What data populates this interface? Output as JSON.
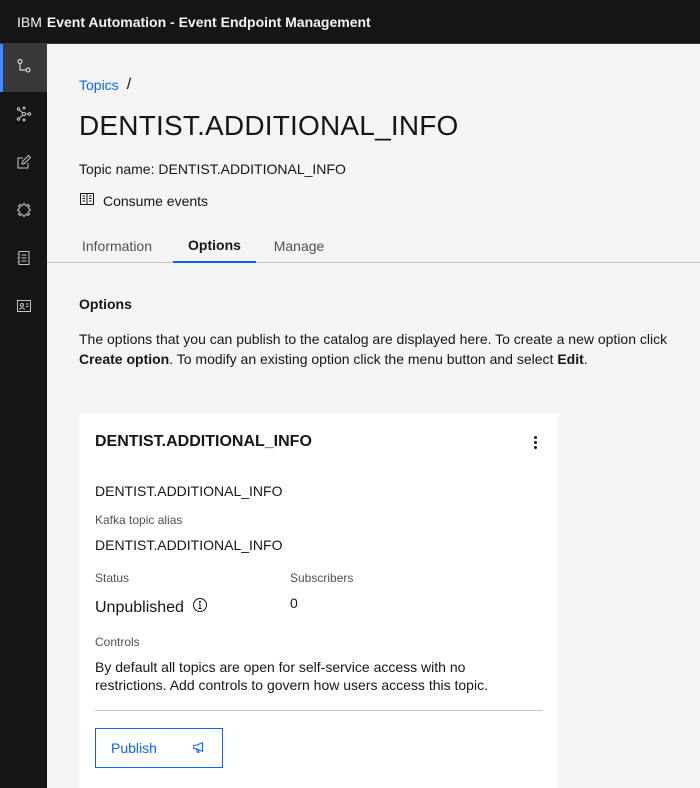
{
  "header": {
    "brand": "IBM",
    "product": "Event Automation - Event Endpoint Management"
  },
  "sidebar": {
    "items": [
      {
        "icon": "topics-icon",
        "active": true
      },
      {
        "icon": "network-icon",
        "active": false
      },
      {
        "icon": "edit-icon",
        "active": false
      },
      {
        "icon": "puzzle-icon",
        "active": false
      },
      {
        "icon": "catalog-icon",
        "active": false
      },
      {
        "icon": "identification-icon",
        "active": false
      }
    ]
  },
  "breadcrumb": {
    "link": "Topics",
    "separator": "/"
  },
  "page": {
    "title": "DENTIST.ADDITIONAL_INFO",
    "topic_name": "Topic name: DENTIST.ADDITIONAL_INFO",
    "consume_label": "Consume events"
  },
  "tabs": [
    {
      "label": "Information",
      "selected": false
    },
    {
      "label": "Options",
      "selected": true
    },
    {
      "label": "Manage",
      "selected": false
    }
  ],
  "options_section": {
    "title": "Options",
    "desc_part1": "The options that you can publish to the catalog are displayed here. To create a new option click ",
    "desc_bold1": "Create option",
    "desc_part2": ". To modify an existing option click the menu button and select ",
    "desc_bold2": "Edit",
    "desc_part3": "."
  },
  "card": {
    "title": "DENTIST.ADDITIONAL_INFO",
    "name": "DENTIST.ADDITIONAL_INFO",
    "alias_label": "Kafka topic alias",
    "alias_value": "DENTIST.ADDITIONAL_INFO",
    "status_label": "Status",
    "status_value": "Unpublished",
    "subscribers_label": "Subscribers",
    "subscribers_value": "0",
    "controls_label": "Controls",
    "controls_text": "By default all topics are open for self-service access with no restrictions. Add controls to govern how users access this topic.",
    "publish_label": "Publish"
  },
  "colors": {
    "accent": "#0f62fe",
    "header_bg": "#161616",
    "page_bg": "#f4f4f4"
  }
}
